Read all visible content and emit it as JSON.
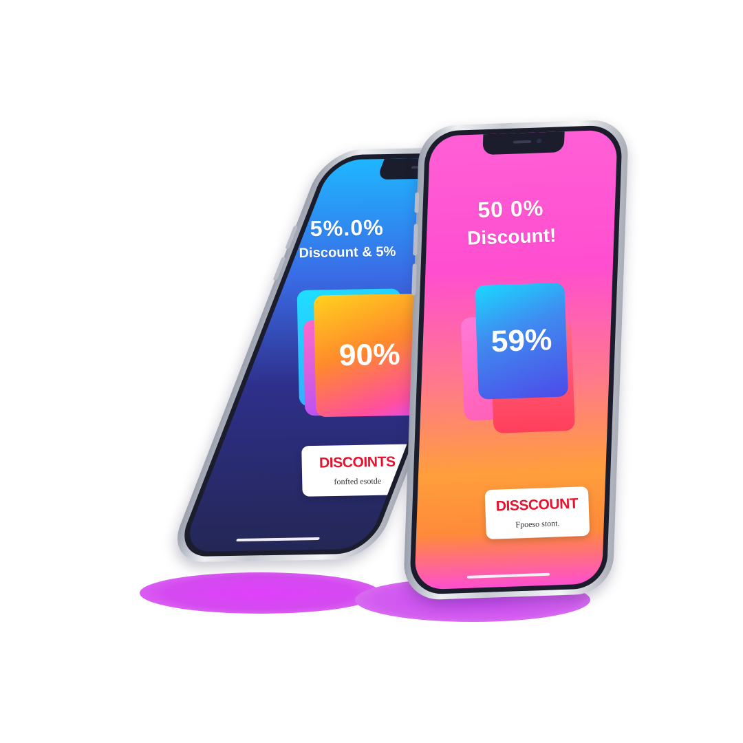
{
  "left_phone": {
    "headline": "5%.0%",
    "subheadline": "Discount & 5%",
    "card_value": "90%",
    "ticket_title": "DISCOINTS",
    "ticket_subtitle": "fonfted esotde"
  },
  "right_phone": {
    "headline": "50 0%",
    "subheadline": "Discount!",
    "card_value": "59%",
    "ticket_title": "DISSCOUNT",
    "ticket_subtitle": "Fpoeso stont."
  },
  "colors": {
    "accent_red": "#e8122e",
    "shadow_magenta": "#d946ef",
    "left_screen_top": "#1fb6ff",
    "left_screen_bottom": "#242755",
    "right_screen_top": "#ff4ed0",
    "right_screen_mid": "#ff9e3c"
  }
}
